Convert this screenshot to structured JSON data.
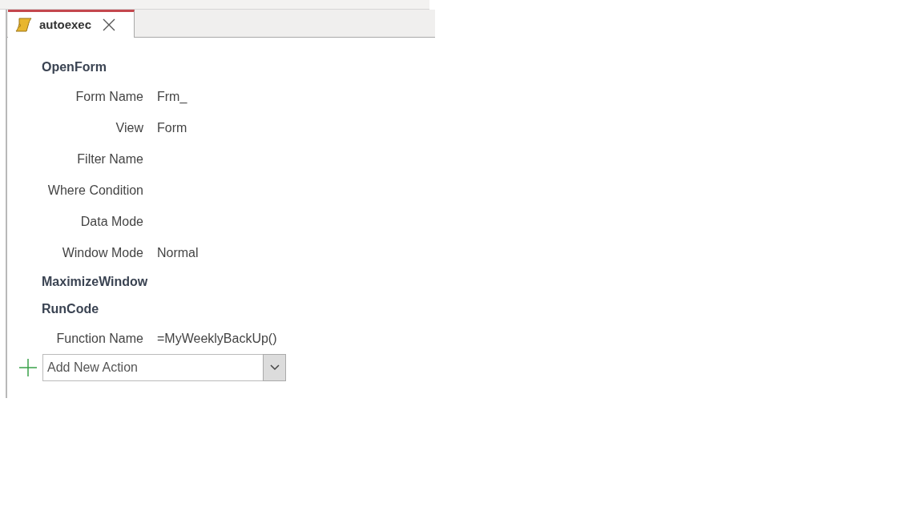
{
  "tab": {
    "title": "autoexec",
    "selected": true
  },
  "actions": [
    {
      "name": "OpenForm",
      "arguments": [
        {
          "label": "Form Name",
          "value": "Frm_"
        },
        {
          "label": "View",
          "value": "Form"
        },
        {
          "label": "Filter Name"
        },
        {
          "label": "Where Condition"
        },
        {
          "label": "Data Mode"
        },
        {
          "label": "Window Mode",
          "value": "Normal"
        }
      ]
    },
    {
      "name": "MaximizeWindow"
    },
    {
      "name": "RunCode",
      "arguments": [
        {
          "label": "Function Name",
          "value": "=MyWeeklyBackUp()"
        }
      ]
    }
  ],
  "add_action": {
    "placeholder": "Add New Action"
  }
}
